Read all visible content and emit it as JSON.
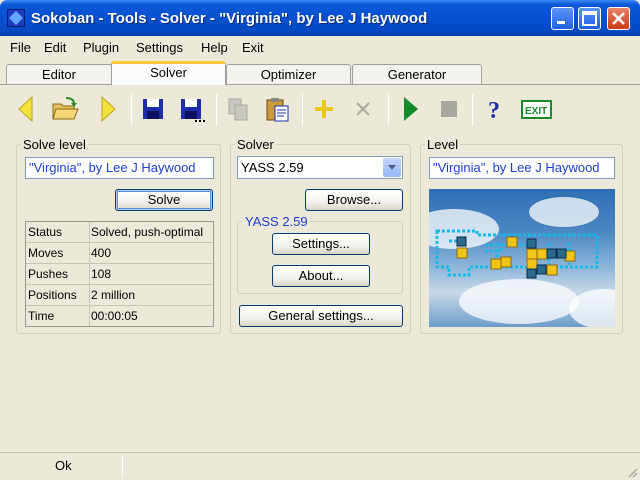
{
  "window": {
    "title": "Sokoban - Tools - Solver - \"Virginia\", by Lee J Haywood"
  },
  "menu": [
    "File",
    "Edit",
    "Plugin",
    "Settings",
    "Help",
    "Exit"
  ],
  "tabs": [
    "Editor",
    "Solver",
    "Optimizer",
    "Generator"
  ],
  "active_tab": "Solver",
  "toolbar": {
    "icons": [
      "back-arrow-icon",
      "open-folder-icon",
      "forward-arrow-icon",
      "save-icon",
      "save-as-icon",
      "copy-icon",
      "paste-icon",
      "add-icon",
      "delete-icon",
      "play-icon",
      "stop-icon",
      "help-icon",
      "exit-icon"
    ],
    "exit_label": "EXIT",
    "help_label": "?"
  },
  "solve_level": {
    "title": "Solve level",
    "level_name": "\"Virginia\", by Lee J Haywood",
    "solve_button": "Solve",
    "stats": [
      {
        "key": "Status",
        "value": "Solved, push-optimal"
      },
      {
        "key": "Moves",
        "value": "400"
      },
      {
        "key": "Pushes",
        "value": "108"
      },
      {
        "key": "Positions",
        "value": "2 million"
      },
      {
        "key": "Time",
        "value": "00:00:05"
      }
    ]
  },
  "solver": {
    "title": "Solver",
    "selected": "YASS 2.59",
    "browse_button": "Browse...",
    "plugin_group": "YASS 2.59",
    "settings_button": "Settings...",
    "about_button": "About...",
    "general_settings_button": "General settings..."
  },
  "level": {
    "title": "Level",
    "level_name": "\"Virginia\", by Lee J Haywood"
  },
  "status_bar": {
    "text": "Ok"
  },
  "colors": {
    "title_bar": "#0650d0",
    "active_tab_accent": "#ffc83c",
    "link_text": "#1a3fd6"
  }
}
